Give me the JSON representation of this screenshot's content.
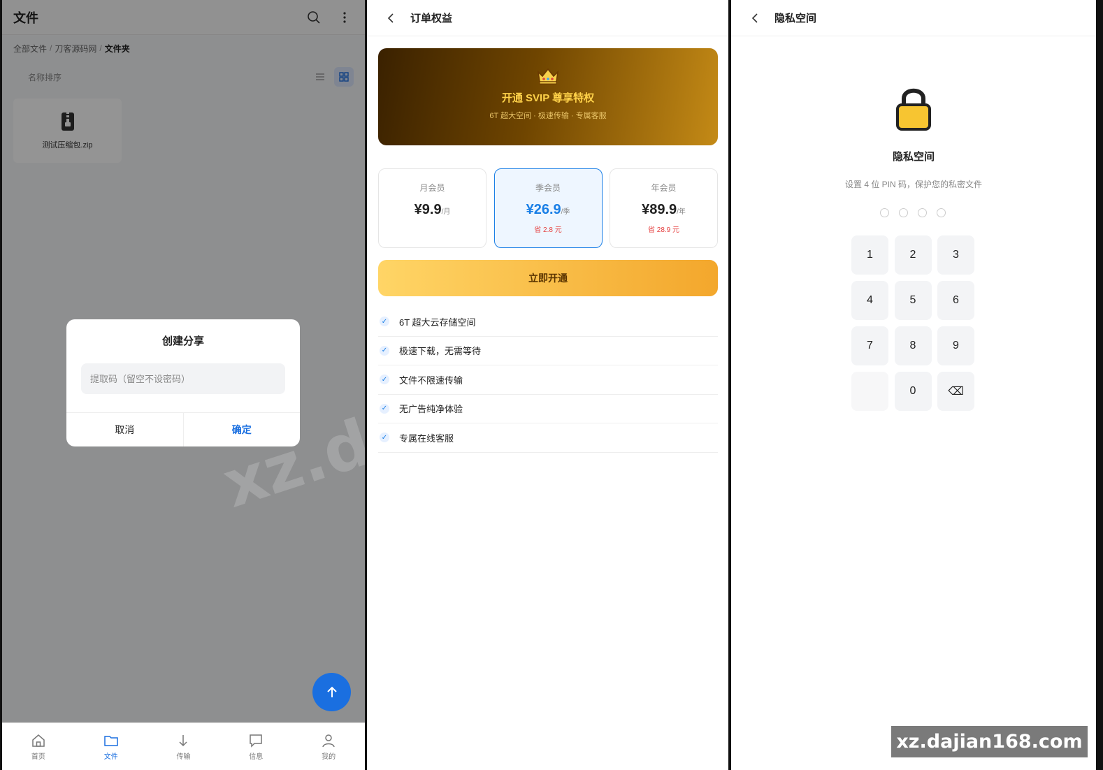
{
  "files": {
    "title": "文件",
    "breadcrumb": [
      "全部文件",
      "刀客源码网",
      "文件夹"
    ],
    "breadcrumb_sep": "/",
    "sort_label": "名称排序",
    "file": {
      "name": "测试压缩包.zip"
    },
    "dialog": {
      "title": "创建分享",
      "input_placeholder": "提取码（留空不设密码）",
      "cancel": "取消",
      "confirm": "确定"
    },
    "tabs": [
      {
        "label": "首页",
        "icon": "home-icon"
      },
      {
        "label": "文件",
        "icon": "folder-icon",
        "active": true
      },
      {
        "label": "传输",
        "icon": "download-icon"
      },
      {
        "label": "信息",
        "icon": "message-icon"
      },
      {
        "label": "我的",
        "icon": "user-icon"
      }
    ],
    "overlay_watermark": "xz.d"
  },
  "order": {
    "title": "订单权益",
    "banner_title": "开通 SVIP 尊享特权",
    "banner_sub": "6T 超大空间 · 极速传输 · 专属客服",
    "plans": [
      {
        "name": "月会员",
        "price": "¥9.9",
        "unit": "/月",
        "save": ""
      },
      {
        "name": "季会员",
        "price": "¥26.9",
        "unit": "/季",
        "save": "省 2.8 元",
        "selected": true
      },
      {
        "name": "年会员",
        "price": "¥89.9",
        "unit": "/年",
        "save": "省 28.9 元"
      }
    ],
    "cta": "立即开通",
    "benefits": [
      "6T 超大云存储空间",
      "极速下载，无需等待",
      "文件不限速传输",
      "无广告纯净体验",
      "专属在线客服"
    ],
    "check_glyph": "✓"
  },
  "private": {
    "title": "隐私空间",
    "heading": "隐私空间",
    "subtitle": "设置 4 位 PIN 码，保护您的私密文件",
    "keys": [
      "1",
      "2",
      "3",
      "4",
      "5",
      "6",
      "7",
      "8",
      "9",
      "",
      "0",
      "⌫"
    ]
  },
  "site_watermark": "xz.dajian168.com",
  "colors": {
    "primary": "#1a6fe0",
    "gold": "#ffd24a",
    "danger": "#e54040"
  }
}
